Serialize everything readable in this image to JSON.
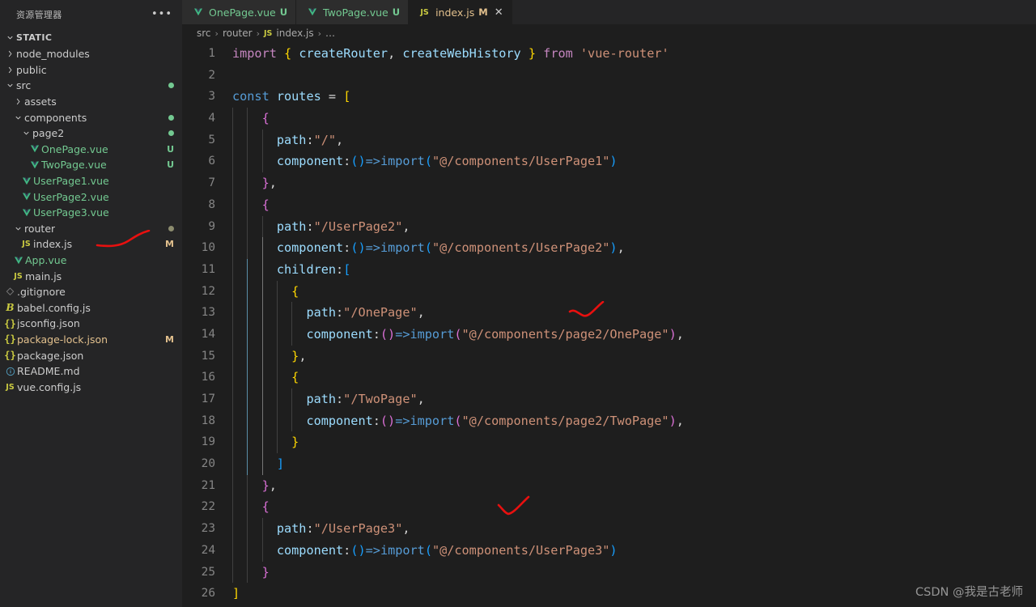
{
  "sidebar": {
    "header_title": "资源管理器",
    "more_icon": "ellipsis-icon",
    "section_label": "STATIC",
    "items": [
      {
        "label": "node_modules",
        "kind": "folder",
        "depth": 1,
        "expanded": false,
        "icon": "chevron-right-icon",
        "badge": "",
        "dot": ""
      },
      {
        "label": "public",
        "kind": "folder",
        "depth": 1,
        "expanded": false,
        "icon": "chevron-right-icon",
        "badge": "",
        "dot": ""
      },
      {
        "label": "src",
        "kind": "folder",
        "depth": 1,
        "expanded": true,
        "icon": "chevron-down-icon",
        "badge": "",
        "dot": "green"
      },
      {
        "label": "assets",
        "kind": "folder",
        "depth": 2,
        "expanded": false,
        "icon": "chevron-right-icon",
        "badge": "",
        "dot": ""
      },
      {
        "label": "components",
        "kind": "folder",
        "depth": 2,
        "expanded": true,
        "icon": "chevron-down-icon",
        "badge": "",
        "dot": "green"
      },
      {
        "label": "page2",
        "kind": "folder",
        "depth": 3,
        "expanded": true,
        "icon": "chevron-down-icon",
        "badge": "",
        "dot": "green"
      },
      {
        "label": "OnePage.vue",
        "kind": "vue",
        "depth": 4,
        "icon": "vue-icon",
        "badge": "U",
        "dot": ""
      },
      {
        "label": "TwoPage.vue",
        "kind": "vue",
        "depth": 4,
        "icon": "vue-icon",
        "badge": "U",
        "dot": ""
      },
      {
        "label": "UserPage1.vue",
        "kind": "vue",
        "depth": 3,
        "icon": "vue-icon",
        "badge": "",
        "dot": ""
      },
      {
        "label": "UserPage2.vue",
        "kind": "vue",
        "depth": 3,
        "icon": "vue-icon",
        "badge": "",
        "dot": ""
      },
      {
        "label": "UserPage3.vue",
        "kind": "vue",
        "depth": 3,
        "icon": "vue-icon",
        "badge": "",
        "dot": ""
      },
      {
        "label": "router",
        "kind": "folder",
        "depth": 2,
        "expanded": true,
        "icon": "chevron-down-icon",
        "badge": "",
        "dot": "grey"
      },
      {
        "label": "index.js",
        "kind": "js",
        "depth": 3,
        "icon": "js-icon",
        "badge": "M",
        "dot": ""
      },
      {
        "label": "App.vue",
        "kind": "vue",
        "depth": 2,
        "icon": "vue-icon",
        "badge": "",
        "dot": ""
      },
      {
        "label": "main.js",
        "kind": "js",
        "depth": 2,
        "icon": "js-icon",
        "badge": "",
        "dot": ""
      },
      {
        "label": ".gitignore",
        "kind": "git",
        "depth": 1,
        "icon": "git-icon",
        "badge": "",
        "dot": ""
      },
      {
        "label": "babel.config.js",
        "kind": "babel",
        "depth": 1,
        "icon": "babel-icon",
        "badge": "",
        "dot": ""
      },
      {
        "label": "jsconfig.json",
        "kind": "json",
        "depth": 1,
        "icon": "json-icon",
        "badge": "",
        "dot": ""
      },
      {
        "label": "package-lock.json",
        "kind": "json-mod",
        "depth": 1,
        "icon": "json-icon",
        "badge": "M",
        "dot": ""
      },
      {
        "label": "package.json",
        "kind": "json",
        "depth": 1,
        "icon": "json-icon",
        "badge": "",
        "dot": ""
      },
      {
        "label": "README.md",
        "kind": "md",
        "depth": 1,
        "icon": "info-icon",
        "badge": "",
        "dot": ""
      },
      {
        "label": "vue.config.js",
        "kind": "js",
        "depth": 1,
        "icon": "js-icon",
        "badge": "",
        "dot": ""
      }
    ]
  },
  "tabs": [
    {
      "label": "OnePage.vue",
      "status": "U",
      "icon": "vue-icon",
      "active": false,
      "closable": false
    },
    {
      "label": "TwoPage.vue",
      "status": "U",
      "icon": "vue-icon",
      "active": false,
      "closable": false
    },
    {
      "label": "index.js",
      "status": "M",
      "icon": "js-icon",
      "active": true,
      "closable": true,
      "close_icon": "close-icon"
    }
  ],
  "breadcrumb": {
    "parts": [
      "src",
      "router",
      "index.js",
      "…"
    ],
    "separator": "›",
    "file_icon": "js-icon"
  },
  "editor": {
    "language": "javascript",
    "first_line": 1,
    "last_line": 26,
    "lines": [
      "import { createRouter, createWebHistory } from 'vue-router'",
      "",
      "const routes = [",
      "    {",
      "      path:\"/\",",
      "      component:()=>import(\"@/components/UserPage1\")",
      "    },",
      "    {",
      "      path:\"/UserPage2\",",
      "      component:()=>import(\"@/components/UserPage2\"),",
      "      children:[",
      "        {",
      "          path:\"/OnePage\",",
      "          component:()=>import(\"@/components/page2/OnePage\"),",
      "        },",
      "        {",
      "          path:\"/TwoPage\",",
      "          component:()=>import(\"@/components/page2/TwoPage\"),",
      "        }",
      "      ]",
      "    },",
      "    {",
      "      path:\"/UserPage3\",",
      "      component:()=>import(\"@/components/UserPage3\")",
      "    }",
      "]"
    ]
  },
  "annotations": {
    "color": "#e8100f",
    "marks": [
      {
        "name": "sidebar-index-js-mark",
        "shape": "swoosh"
      },
      {
        "name": "children-open-bracket-check",
        "shape": "check"
      },
      {
        "name": "children-close-bracket-check",
        "shape": "check"
      }
    ]
  },
  "watermark": {
    "text": "CSDN @我是古老师"
  }
}
